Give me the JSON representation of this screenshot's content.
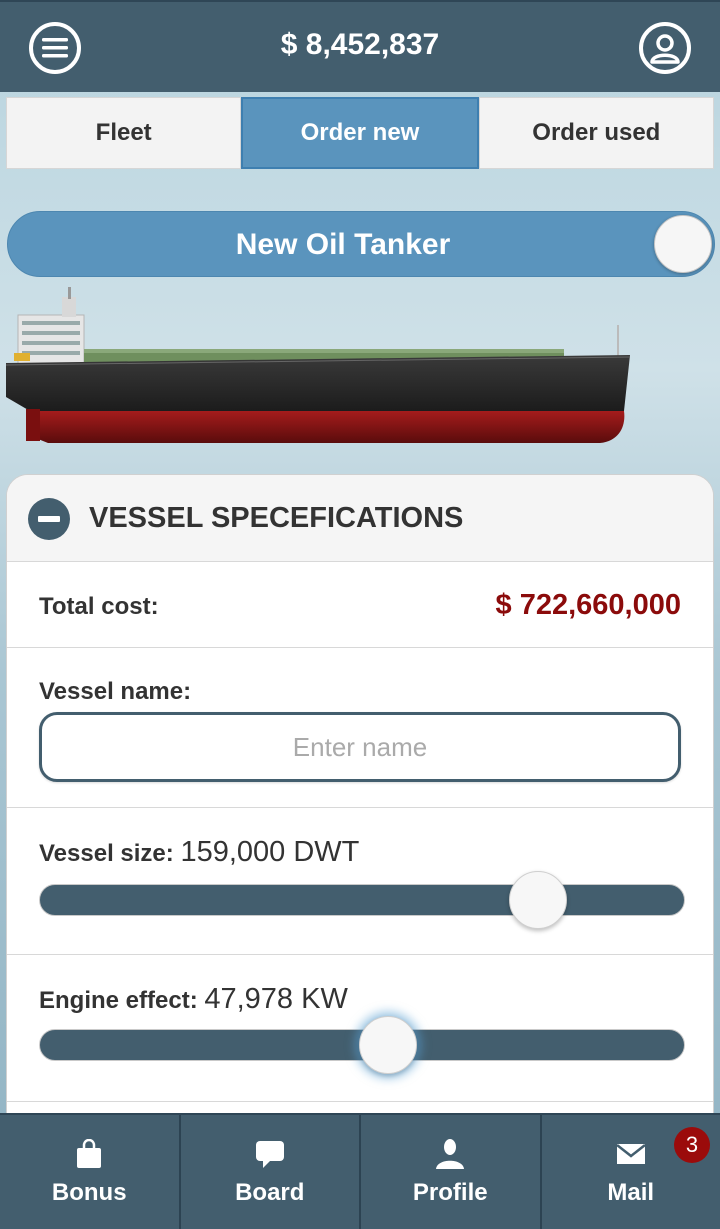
{
  "header": {
    "balance": "$ 8,452,837",
    "menu_icon": "hamburger-icon",
    "user_icon": "user-icon"
  },
  "tabs": [
    {
      "label": "Fleet",
      "active": false
    },
    {
      "label": "Order new",
      "active": true
    },
    {
      "label": "Order used",
      "active": false
    }
  ],
  "vessel_type_toggle": {
    "label": "New Oil Tanker",
    "on": false
  },
  "specs": {
    "title": "VESSEL SPECEFICATIONS",
    "total_cost_label": "Total cost:",
    "total_cost_value": "$ 722,660,000",
    "vessel_name_label": "Vessel name:",
    "vessel_name_placeholder": "Enter name",
    "vessel_name_value": "",
    "vessel_size_label": "Vessel size:",
    "vessel_size_value": "159,000 DWT",
    "vessel_size_fraction": 0.8,
    "engine_label": "Engine effect:",
    "engine_value": "47,978 KW",
    "engine_fraction": 0.545
  },
  "bottom_nav": [
    {
      "label": "Bonus",
      "icon": "shopping-bag-icon"
    },
    {
      "label": "Board",
      "icon": "chat-bubble-icon"
    },
    {
      "label": "Profile",
      "icon": "person-icon"
    },
    {
      "label": "Mail",
      "icon": "envelope-icon",
      "badge": "3"
    }
  ],
  "colors": {
    "bar": "#435e6e",
    "accent": "#5a94bd",
    "cost": "#8b0b0b",
    "badge": "#9b0b0b"
  }
}
